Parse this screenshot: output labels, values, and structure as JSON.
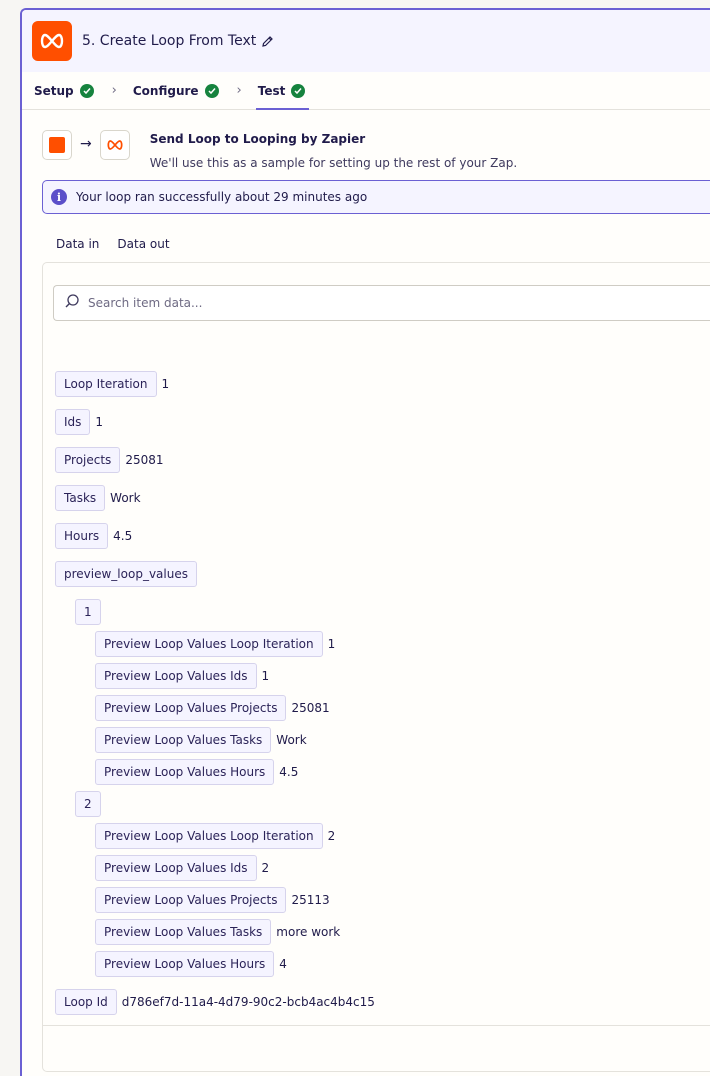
{
  "header": {
    "title": "5. Create Loop From Text"
  },
  "steps": [
    {
      "label": "Setup"
    },
    {
      "label": "Configure"
    },
    {
      "label": "Test"
    }
  ],
  "trigger": {
    "title": "Send Loop to Looping by Zapier",
    "subtitle": "We'll use this as a sample for setting up the rest of your Zap."
  },
  "banner": {
    "text": "Your loop ran successfully about 29 minutes ago"
  },
  "data_tabs": [
    {
      "label": "Data in"
    },
    {
      "label": "Data out"
    }
  ],
  "search": {
    "placeholder": "Search item data..."
  },
  "fields": {
    "loop_iteration": {
      "key": "Loop Iteration",
      "value": "1"
    },
    "ids": {
      "key": "Ids",
      "value": "1"
    },
    "projects": {
      "key": "Projects",
      "value": "25081"
    },
    "tasks": {
      "key": "Tasks",
      "value": "Work"
    },
    "hours": {
      "key": "Hours",
      "value": "4.5"
    },
    "preview": {
      "key": "preview_loop_values"
    },
    "loop_id": {
      "key": "Loop Id",
      "value": "d786ef7d-11a4-4d79-90c2-bcb4ac4b4c15"
    }
  },
  "preview_items": [
    {
      "index": "1",
      "rows": [
        {
          "key": "Preview Loop Values Loop Iteration",
          "value": "1"
        },
        {
          "key": "Preview Loop Values Ids",
          "value": "1"
        },
        {
          "key": "Preview Loop Values Projects",
          "value": "25081"
        },
        {
          "key": "Preview Loop Values Tasks",
          "value": "Work"
        },
        {
          "key": "Preview Loop Values Hours",
          "value": "4.5"
        }
      ]
    },
    {
      "index": "2",
      "rows": [
        {
          "key": "Preview Loop Values Loop Iteration",
          "value": "2"
        },
        {
          "key": "Preview Loop Values Ids",
          "value": "2"
        },
        {
          "key": "Preview Loop Values Projects",
          "value": "25113"
        },
        {
          "key": "Preview Loop Values Tasks",
          "value": "more work"
        },
        {
          "key": "Preview Loop Values Hours",
          "value": "4"
        }
      ]
    }
  ],
  "colors": {
    "brand": "#ff4f00",
    "accent": "#6b60d3",
    "success": "#16833e"
  }
}
